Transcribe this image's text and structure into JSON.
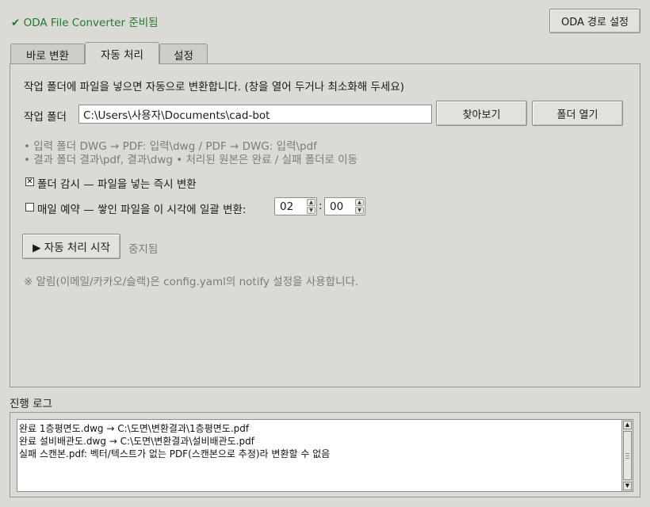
{
  "status": {
    "text": "✔ ODA File Converter 준비됨"
  },
  "header": {
    "oda_path_button": "ODA 경로 설정"
  },
  "tabs": [
    {
      "label": "바로 변환",
      "active": false
    },
    {
      "label": "자동 처리",
      "active": true
    },
    {
      "label": "설정",
      "active": false
    }
  ],
  "auto": {
    "intro": "작업 폴더에 파일을 넣으면 자동으로 변환합니다. (창을 열어 두거나 최소화해 두세요)",
    "folder_label": "작업 폴더",
    "folder_value": "C:\\Users\\사용자\\Documents\\cad-bot",
    "browse_button": "찾아보기",
    "open_folder_button": "폴더 열기",
    "hint_line1": "• 입력 폴더  DWG → PDF: 입력\\dwg   /   PDF → DWG: 입력\\pdf",
    "hint_line2": "• 결과 폴더  결과\\pdf, 결과\\dwg      • 처리된 원본은 완료 / 실패 폴더로 이동",
    "watch_checkbox": {
      "checked": true,
      "label": "폴더 감시 — 파일을 넣는 즉시 변환"
    },
    "schedule_checkbox": {
      "checked": false,
      "label": "매일 예약 — 쌓인 파일을 이 시각에 일괄 변환:"
    },
    "hour": "02",
    "time_sep": ":",
    "minute": "00",
    "start_button": "▶ 자동 처리 시작",
    "run_status": "중지됨",
    "notice": "※ 알림(이메일/카카오/슬랙)은 config.yaml의 notify 설정을 사용합니다."
  },
  "log": {
    "title": "진행 로그",
    "lines": [
      "완료  1층평면도.dwg → C:\\도면\\변환결과\\1층평면도.pdf",
      "완료  설비배관도.dwg → C:\\도면\\변환결과\\설비배관도.pdf",
      "실패  스캔본.pdf: 벡터/텍스트가 없는 PDF(스캔본으로 추정)라 변환할 수 없음"
    ]
  },
  "colors": {
    "status_green": "#1f7a35",
    "window_bg": "#dcdad5",
    "muted_text": "#7d7b76"
  }
}
